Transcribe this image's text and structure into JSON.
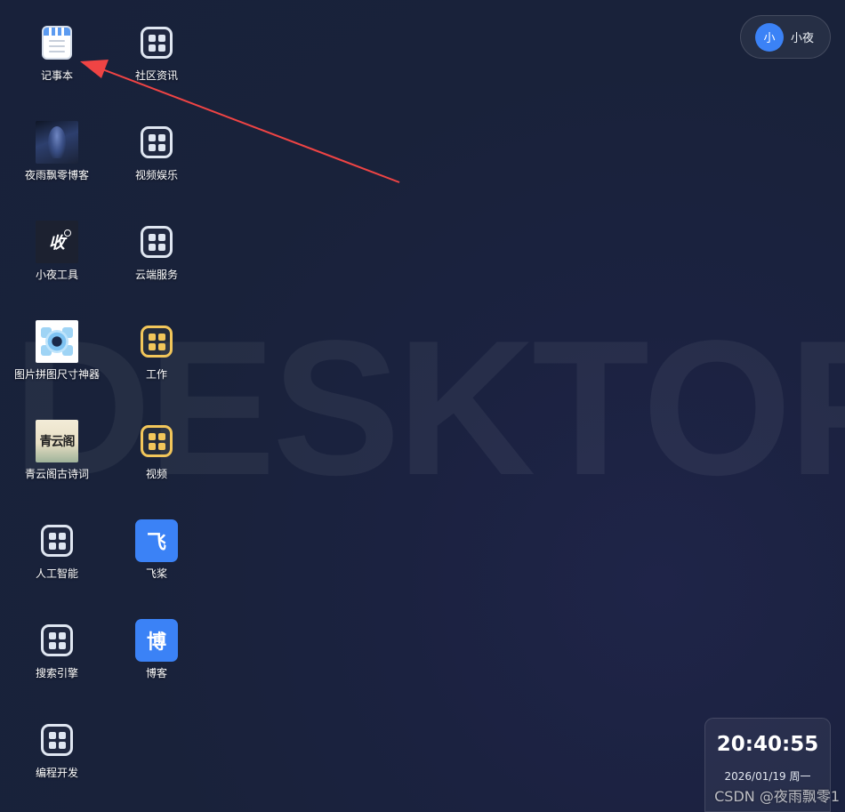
{
  "watermark_bg": "DESKTOP",
  "icons_left": [
    {
      "label": "记事本",
      "icon": "notepad-icon"
    },
    {
      "label": "夜雨飘零博客",
      "icon": "blog-thumbnail"
    },
    {
      "label": "小夜工具",
      "icon": "tool-thumbnail"
    },
    {
      "label": "图片拼图尺寸神器",
      "icon": "puzzle-thumbnail"
    },
    {
      "label": "青云阁古诗词",
      "icon": "poem-thumbnail"
    },
    {
      "label": "人工智能",
      "icon": "app-grid-icon"
    },
    {
      "label": "搜索引擎",
      "icon": "app-grid-icon"
    },
    {
      "label": "编程开发",
      "icon": "app-grid-icon"
    }
  ],
  "icons_right": [
    {
      "label": "社区资讯",
      "icon": "app-grid-icon"
    },
    {
      "label": "视频娱乐",
      "icon": "app-grid-icon"
    },
    {
      "label": "云端服务",
      "icon": "app-grid-icon"
    },
    {
      "label": "工作",
      "icon": "folder-grid-icon-yellow"
    },
    {
      "label": "视频",
      "icon": "folder-grid-icon-yellow"
    },
    {
      "label": "飞桨",
      "icon": "feijiang-tile",
      "glyph": "飞"
    },
    {
      "label": "博客",
      "icon": "blog-tile",
      "glyph": "博"
    }
  ],
  "thumbnails": {
    "tool_glyph": "收",
    "poem_text": "青云阁"
  },
  "user": {
    "avatar_text": "小",
    "name": "小夜"
  },
  "clock": {
    "time": "20:40:55",
    "date": "2026/01/19 周一"
  },
  "credit": "CSDN @夜雨飘零1",
  "colors": {
    "background": "#1a2234",
    "accent_blue": "#3b82f6",
    "folder_yellow": "#f2c65a",
    "arrow_red": "#ef4444"
  }
}
